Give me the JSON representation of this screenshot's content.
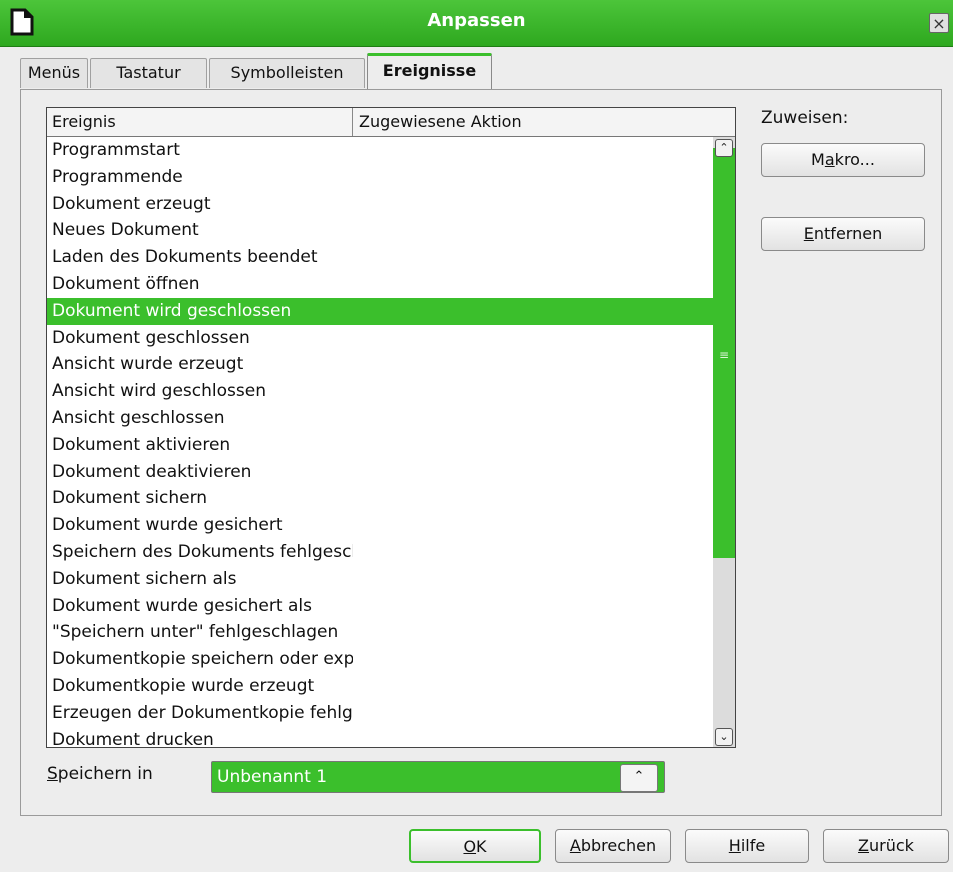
{
  "window": {
    "title": "Anpassen",
    "close_symbol": "×"
  },
  "tabs": [
    {
      "label": "Menüs",
      "active": false
    },
    {
      "label": "Tastatur",
      "active": false
    },
    {
      "label": "Symbolleisten",
      "active": false
    },
    {
      "label": "Ereignisse",
      "active": true
    }
  ],
  "events_table": {
    "columns": [
      "Ereignis",
      "Zugewiesene Aktion"
    ],
    "selected_index": 6,
    "rows": [
      "Programmstart",
      "Programmende",
      "Dokument erzeugt",
      "Neues Dokument",
      "Laden des Dokuments beendet",
      "Dokument öffnen",
      "Dokument wird geschlossen",
      "Dokument geschlossen",
      "Ansicht wurde erzeugt",
      "Ansicht wird geschlossen",
      "Ansicht geschlossen",
      "Dokument aktivieren",
      "Dokument deaktivieren",
      "Dokument sichern",
      "Dokument wurde gesichert",
      "Speichern des Dokuments fehlgeschlagen",
      "Dokument sichern als",
      "Dokument wurde gesichert als",
      "\"Speichern unter\" fehlgeschlagen",
      "Dokumentkopie speichern oder exportieren",
      "Dokumentkopie wurde erzeugt",
      "Erzeugen der Dokumentkopie fehlgeschlagen",
      "Dokument drucken"
    ]
  },
  "assign": {
    "label": "Zuweisen:",
    "macro_button": {
      "mnemonic_before": "M",
      "mnemonic": "a",
      "after": "kro..."
    },
    "remove_button": {
      "mnemonic_before": "",
      "mnemonic": "E",
      "after": "ntfernen"
    }
  },
  "save_in": {
    "label_mnemonic": "S",
    "label_rest": "peichern in",
    "value": "Unbenannt 1"
  },
  "footer_buttons": {
    "ok": {
      "mnemonic": "O",
      "rest": "K"
    },
    "cancel": {
      "mnemonic": "A",
      "rest": "bbrechen"
    },
    "help": {
      "mnemonic": "H",
      "rest": "ilfe"
    },
    "back": {
      "mnemonic": "Z",
      "rest": "urück"
    }
  },
  "colors": {
    "accent": "#3bbf2c",
    "title_bar": "#3cb72d"
  }
}
